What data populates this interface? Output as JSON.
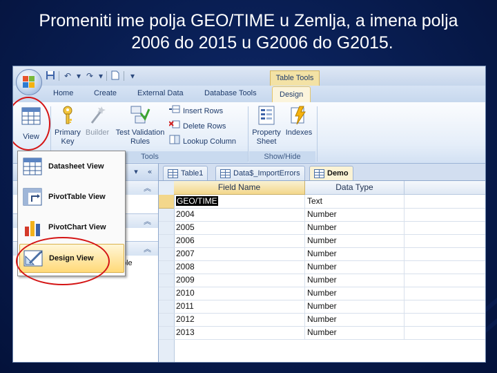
{
  "slide": {
    "title_line1": "Promeniti ime polja GEO/TIME u Zemlja, a imena polja",
    "title_line2": "2006 do 2015 u G2006 do G2015."
  },
  "titlebar": {
    "context_tab": "Table Tools",
    "qat_icons": [
      "save-icon",
      "undo-icon",
      "redo-icon",
      "new-icon",
      "customize-icon"
    ]
  },
  "ribbon": {
    "tabs": [
      "Home",
      "Create",
      "External Data",
      "Database Tools",
      "Design"
    ],
    "active_tab": "Design",
    "view_label": "View",
    "primary_key_label": [
      "Primary",
      "Key"
    ],
    "builder_label": "Builder",
    "test_validation_label": [
      "Test Validation",
      "Rules"
    ],
    "insert_rows": "Insert Rows",
    "delete_rows": "Delete Rows",
    "lookup_column": "Lookup Column",
    "tools_group": "Tools",
    "property_sheet_label": [
      "Property",
      "Sheet"
    ],
    "indexes_label": "Indexes",
    "show_hide_group": "Show/Hide"
  },
  "view_menu": {
    "items": [
      "Datasheet View",
      "PivotTable View",
      "PivotChart View",
      "Design View"
    ],
    "highlighted": "Design View"
  },
  "nav_pane": {
    "partial_text": "ble"
  },
  "doc_tabs": [
    "Table1",
    "Data$_ImportErrors",
    "Demo"
  ],
  "active_doc_tab": "Demo",
  "design_grid": {
    "headers": [
      "Field Name",
      "Data Type"
    ],
    "rows": [
      {
        "field": "GEO/TIME",
        "type": "Text"
      },
      {
        "field": "2004",
        "type": "Number"
      },
      {
        "field": "2005",
        "type": "Number"
      },
      {
        "field": "2006",
        "type": "Number"
      },
      {
        "field": "2007",
        "type": "Number"
      },
      {
        "field": "2008",
        "type": "Number"
      },
      {
        "field": "2009",
        "type": "Number"
      },
      {
        "field": "2010",
        "type": "Number"
      },
      {
        "field": "2011",
        "type": "Number"
      },
      {
        "field": "2012",
        "type": "Number"
      },
      {
        "field": "2013",
        "type": "Number"
      }
    ]
  },
  "colors": {
    "slide_bg": "#081c4f",
    "highlight_ellipse": "#d41414",
    "active_tab_bg": "#fbf4dc"
  }
}
